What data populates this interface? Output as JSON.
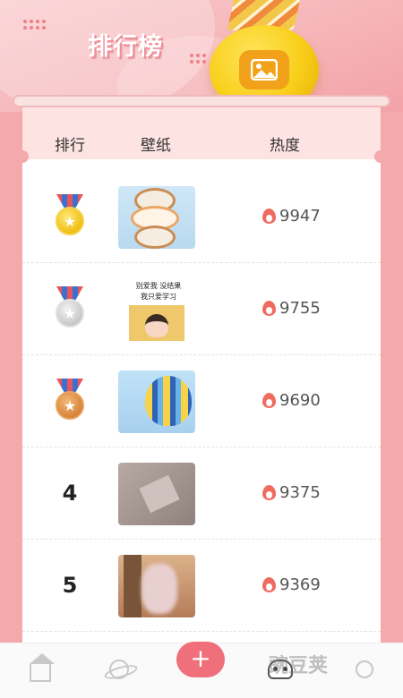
{
  "header": {
    "title": "排行榜",
    "medal_icon": "image-icon"
  },
  "columns": {
    "rank": "排行",
    "wallpaper": "壁纸",
    "heat": "热度"
  },
  "rows": [
    {
      "rank": "1",
      "badge": "gold-medal-icon",
      "thumb": "hamster-stack",
      "heat": "9947"
    },
    {
      "rank": "2",
      "badge": "silver-medal-icon",
      "thumb": "study-girl",
      "thumb_text": "别爱我 没结果\n我只爱学习",
      "heat": "9755"
    },
    {
      "rank": "3",
      "badge": "bronze-medal-icon",
      "thumb": "hot-air-balloon",
      "heat": "9690"
    },
    {
      "rank": "4",
      "thumb": "room-sketch",
      "heat": "9375"
    },
    {
      "rank": "5",
      "thumb": "portrait",
      "heat": "9369"
    }
  ],
  "nav": {
    "items": [
      "home-icon",
      "planet-icon",
      "add-button",
      "panda-icon",
      "user-icon"
    ],
    "add_label": "+"
  },
  "watermark": "豌豆荚",
  "colors": {
    "background": "#f4a9ad",
    "accent": "#ef6f7a",
    "flame": "#f06b5f",
    "header_strip": "#fde3e1"
  }
}
